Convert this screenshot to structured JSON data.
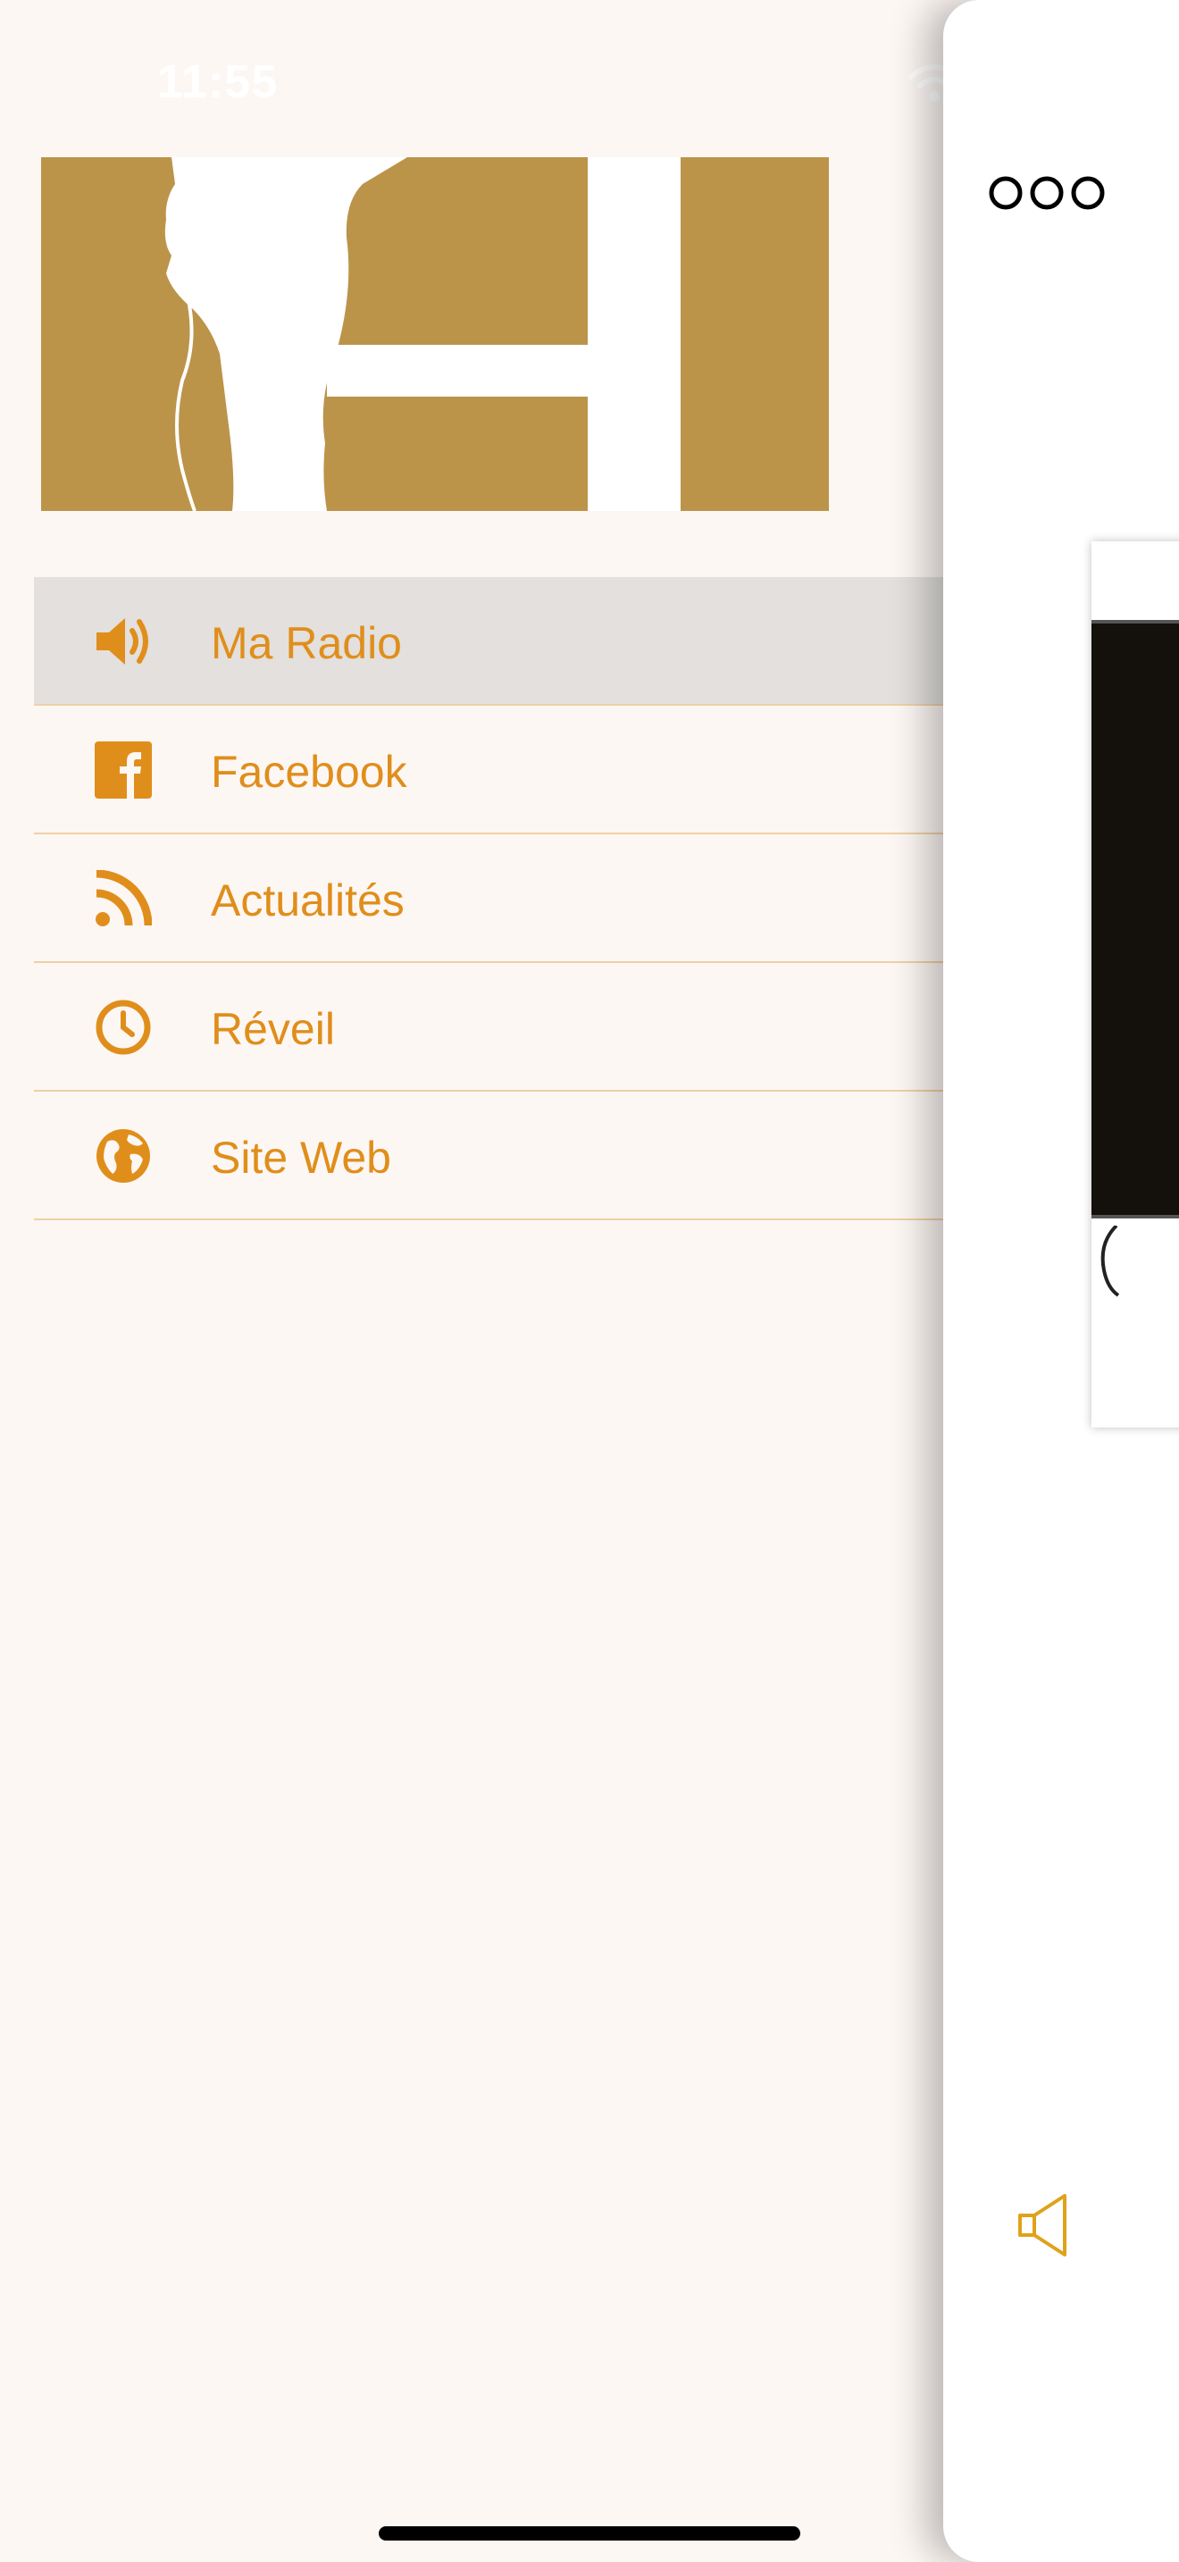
{
  "status_bar": {
    "time": "11:55"
  },
  "drawer": {
    "menu": [
      {
        "id": "ma-radio",
        "label": "Ma Radio",
        "icon": "speaker-icon",
        "active": true
      },
      {
        "id": "facebook",
        "label": "Facebook",
        "icon": "facebook-icon",
        "active": false
      },
      {
        "id": "actualites",
        "label": "Actualités",
        "icon": "rss-icon",
        "active": false
      },
      {
        "id": "reveil",
        "label": "Réveil",
        "icon": "clock-icon",
        "active": false
      },
      {
        "id": "site-web",
        "label": "Site Web",
        "icon": "globe-icon",
        "active": false
      }
    ]
  },
  "panel": {
    "menu_icon": "three-circles-icon",
    "volume_icon": "speaker-outline-icon"
  },
  "colors": {
    "accent": "#e08e1b",
    "banner": "#bb944a",
    "active_row": "#e3e0dd",
    "divider": "#efd0a4",
    "drawer_bg": "#fdf7f4",
    "volume_icon": "#e0a21b"
  }
}
